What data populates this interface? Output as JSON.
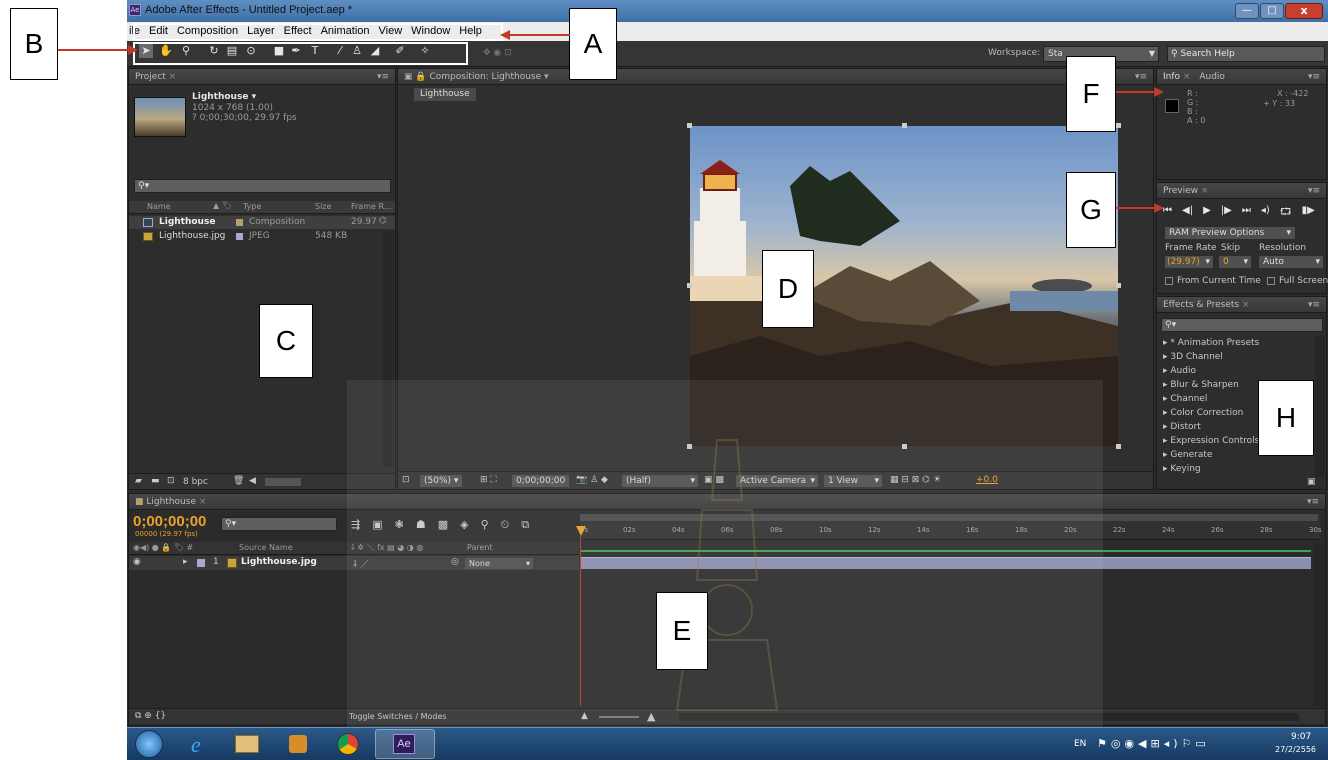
{
  "app": {
    "title": "Adobe After Effects - Untitled Project.aep *"
  },
  "menu": [
    "ile",
    "Edit",
    "Composition",
    "Layer",
    "Effect",
    "Animation",
    "View",
    "Window",
    "Help"
  ],
  "toolbar": {
    "workspace_label": "Workspace:",
    "workspace_value": "Sta",
    "search_placeholder": "Search Help"
  },
  "project": {
    "tab": "Project",
    "item_name": "Lighthouse ▾",
    "item_dims": "1024 x 768 (1.00)",
    "item_duration": "? 0;00;30;00, 29.97 fps",
    "columns": [
      "Name",
      "Type",
      "Size",
      "Frame R..."
    ],
    "rows": [
      {
        "name": "Lighthouse",
        "type": "Composition",
        "size": "",
        "rate": "29.97"
      },
      {
        "name": "Lighthouse.jpg",
        "type": "JPEG",
        "size": "548 KB",
        "rate": ""
      }
    ],
    "bpc": "8 bpc"
  },
  "composition": {
    "tab": "Composition: Lighthouse",
    "breadcrumb": "Lighthouse",
    "zoom": "(50%)",
    "timecode": "0;00;00;00",
    "resolution": "(Half)",
    "camera": "Active Camera",
    "view": "1 View",
    "exposure": "+0.0"
  },
  "info": {
    "tabs": [
      "Info",
      "Audio"
    ],
    "r": "R :",
    "g": "G :",
    "b": "B :",
    "a": "A : 0",
    "x": "X : -422",
    "y": "+ Y : 33"
  },
  "preview": {
    "tab": "Preview",
    "ram_options": "RAM Preview Options",
    "frame_rate_label": "Frame Rate",
    "skip_label": "Skip",
    "resolution_label": "Resolution",
    "frame_rate": "(29.97)",
    "skip": "0",
    "resolution": "Auto",
    "from_current": "From Current Time",
    "full_screen": "Full Screen"
  },
  "effects": {
    "tab": "Effects & Presets",
    "items": [
      "▸ * Animation Presets",
      "▸ 3D Channel",
      "▸ Audio",
      "▸ Blur & Sharpen",
      "▸ Channel",
      "▸ Color Correction",
      "▸ Distort",
      "▸ Expression Controls",
      "▸ Generate",
      "▸ Keying"
    ]
  },
  "timeline": {
    "tab": "Lighthouse",
    "timecode": "0;00;00;00",
    "timecode_sub": "00000 (29.97 fps)",
    "col_source": "Source Name",
    "col_parent": "Parent",
    "layer_num": "1",
    "layer_name": "Lighthouse.jpg",
    "parent_value": "None",
    "toggle": "Toggle Switches / Modes",
    "ruler": [
      "0s",
      "02s",
      "04s",
      "06s",
      "08s",
      "10s",
      "12s",
      "14s",
      "16s",
      "18s",
      "20s",
      "22s",
      "24s",
      "26s",
      "28s",
      "30s"
    ]
  },
  "taskbar": {
    "lang": "EN",
    "time": "9:07",
    "date": "27/2/2556",
    "ae": "Ae"
  },
  "callouts": [
    "A",
    "B",
    "C",
    "D",
    "E",
    "F",
    "G",
    "H"
  ],
  "colors": {
    "accent_orange": "#e8a22b",
    "arrow_red": "#c0392b",
    "panel_bg": "#2d2d2d"
  }
}
